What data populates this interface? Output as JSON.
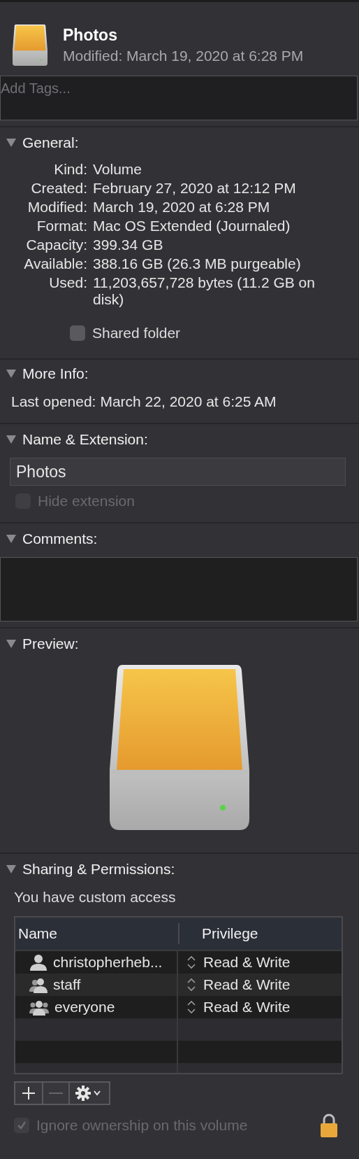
{
  "header": {
    "title": "Photos",
    "subtitle": "Modified: March 19, 2020 at 6:28 PM"
  },
  "tags": {
    "placeholder": "Add Tags..."
  },
  "general": {
    "title": "General:",
    "expanded": true,
    "rows": [
      {
        "label": "Kind:",
        "value": "Volume"
      },
      {
        "label": "Created:",
        "value": "February 27, 2020 at 12:12 PM"
      },
      {
        "label": "Modified:",
        "value": "March 19, 2020 at 6:28 PM"
      },
      {
        "label": "Format:",
        "value": "Mac OS Extended (Journaled)"
      },
      {
        "label": "Capacity:",
        "value": "399.34 GB"
      },
      {
        "label": "Available:",
        "value": "388.16 GB (26.3 MB purgeable)"
      },
      {
        "label": "Used:",
        "value": "11,203,657,728 bytes (11.2 GB on disk)"
      }
    ],
    "shared_folder": {
      "label": "Shared folder",
      "checked": false,
      "disabled": false
    }
  },
  "more_info": {
    "title": "More Info:",
    "expanded": true,
    "label": "Last opened:",
    "value": "March 22, 2020 at 6:25 AM"
  },
  "name_extension": {
    "title": "Name & Extension:",
    "expanded": true,
    "name": "Photos",
    "hide_extension": {
      "label": "Hide extension",
      "checked": false,
      "disabled": true
    }
  },
  "comments": {
    "title": "Comments:",
    "expanded": true
  },
  "preview": {
    "title": "Preview:",
    "expanded": true
  },
  "sharing": {
    "title": "Sharing & Permissions:",
    "expanded": true,
    "access": "You have custom access",
    "columns": [
      "Name",
      "Privilege"
    ],
    "rows": [
      {
        "kind": "user",
        "name": "christopherheb...",
        "privilege": "Read & Write"
      },
      {
        "kind": "group",
        "name": "staff",
        "privilege": "Read & Write"
      },
      {
        "kind": "everyone",
        "name": "everyone",
        "privilege": "Read & Write"
      }
    ],
    "buttons": [
      {
        "kind": "add",
        "disabled": false
      },
      {
        "kind": "remove",
        "disabled": true
      },
      {
        "kind": "action",
        "disabled": false
      }
    ],
    "ignore_ownership": {
      "label": "Ignore ownership on this volume",
      "checked": true,
      "disabled": true
    },
    "locked": true
  }
}
